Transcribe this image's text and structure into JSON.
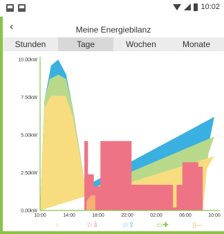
{
  "status_bar": {
    "time": "10:02"
  },
  "header": {
    "back_icon": "chevron-left-icon",
    "title": "Meine Energiebilanz"
  },
  "tabs": [
    {
      "label": "Stunden",
      "active": false
    },
    {
      "label": "Tage",
      "active": true
    },
    {
      "label": "Wochen",
      "active": false
    },
    {
      "label": "Monate",
      "active": false
    }
  ],
  "colors": {
    "solar": "#f8dc80",
    "battery_discharge": "#b9d98a",
    "grid_import": "#3ab0e0",
    "consumption": "#ee7485",
    "battery_charge": "#f7b171",
    "axis": "#8bc34a"
  },
  "legend": [
    {
      "icon": "sun-icon",
      "color": "#f7b171"
    },
    {
      "icon": "house-consumption-icon",
      "color": "#ee7485"
    },
    {
      "icon": "grid-icon",
      "color": "#3ab0e0"
    },
    {
      "icon": "battery-icon",
      "color": "#8bc34a"
    },
    {
      "icon": "battery-low-icon",
      "color": "#f7b171"
    }
  ],
  "chart_data": {
    "type": "area",
    "y_unit": "kW",
    "ylim": [
      0,
      10
    ],
    "yticks": [
      "0.00kW",
      "2.50kW",
      "5.00kW",
      "7.50kW",
      "10.00kW"
    ],
    "xticks": [
      "10:00",
      "14:00",
      "18:00",
      "22:00",
      "02:00",
      "06:00",
      "10:00"
    ],
    "xlim": [
      0,
      24
    ],
    "series": [
      {
        "key": "solar",
        "points": [
          [
            0.0,
            0.0
          ],
          [
            0.6,
            6.8
          ],
          [
            1.5,
            7.6
          ],
          [
            3.5,
            7.6
          ],
          [
            4.5,
            6.2
          ],
          [
            5.5,
            3.6
          ],
          [
            6.7,
            0.0
          ],
          [
            22.4,
            0.0
          ],
          [
            23.0,
            2.8
          ],
          [
            24.0,
            3.6
          ]
        ]
      },
      {
        "key": "battery_discharge",
        "points": [
          [
            0.0,
            0.0
          ],
          [
            0.6,
            7.3
          ],
          [
            1.3,
            8.7
          ],
          [
            2.5,
            9.0
          ],
          [
            3.6,
            8.7
          ],
          [
            4.5,
            6.8
          ],
          [
            5.5,
            3.8
          ],
          [
            6.7,
            0.0
          ],
          [
            22.4,
            0.0
          ],
          [
            23.2,
            3.8
          ],
          [
            24.0,
            4.9
          ]
        ]
      },
      {
        "key": "grid_import",
        "points": [
          [
            0.0,
            0.0
          ],
          [
            0.6,
            7.3
          ],
          [
            1.5,
            9.6
          ],
          [
            2.5,
            10.0
          ],
          [
            3.6,
            9.0
          ],
          [
            4.5,
            6.8
          ],
          [
            5.5,
            3.8
          ],
          [
            6.7,
            0.0
          ],
          [
            22.4,
            0.0
          ],
          [
            23.2,
            4.3
          ],
          [
            24.0,
            6.2
          ]
        ]
      },
      {
        "key": "consumption",
        "points": [
          [
            6.1,
            0.0
          ],
          [
            6.1,
            4.6
          ],
          [
            6.6,
            4.6
          ],
          [
            6.6,
            2.4
          ],
          [
            7.4,
            2.4
          ],
          [
            7.4,
            1.6
          ],
          [
            8.3,
            1.6
          ],
          [
            8.3,
            4.6
          ],
          [
            12.6,
            4.6
          ],
          [
            12.6,
            1.7
          ],
          [
            15.3,
            1.7
          ],
          [
            15.3,
            1.7
          ],
          [
            18.3,
            1.7
          ],
          [
            18.3,
            0.2
          ],
          [
            18.8,
            0.2
          ],
          [
            18.8,
            1.7
          ],
          [
            19.6,
            1.7
          ],
          [
            19.6,
            3.2
          ],
          [
            21.8,
            3.2
          ],
          [
            21.8,
            2.9
          ],
          [
            22.4,
            2.9
          ],
          [
            22.4,
            0.0
          ]
        ]
      },
      {
        "key": "battery_charge",
        "points": [
          [
            6.4,
            0.0
          ],
          [
            6.4,
            0.6
          ],
          [
            7.0,
            1.0
          ],
          [
            7.6,
            1.0
          ],
          [
            7.6,
            0.0
          ]
        ]
      }
    ]
  }
}
